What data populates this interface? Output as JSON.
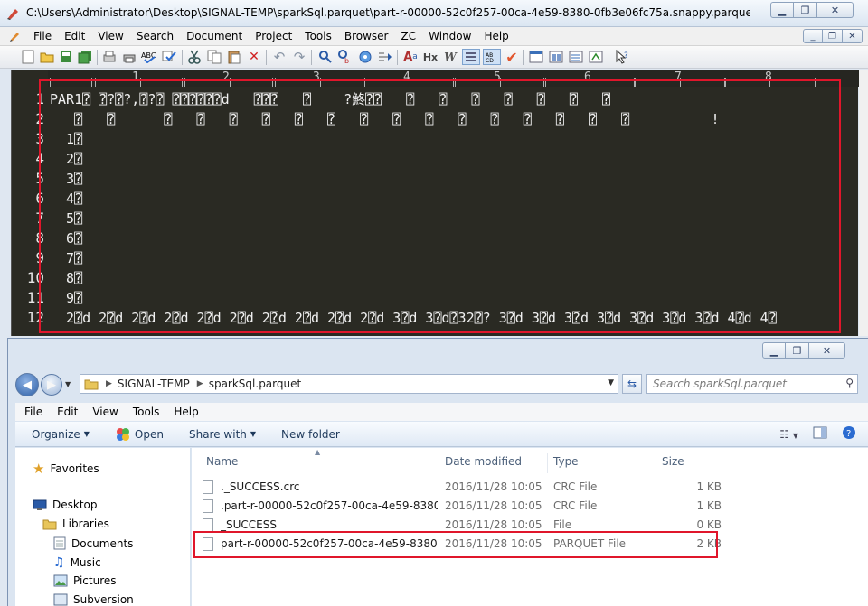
{
  "editplus": {
    "title": "C:\\Users\\Administrator\\Desktop\\SIGNAL-TEMP\\sparkSql.parquet\\part-r-00000-52c0f257-00ca-4e59-8380-0fb3e06fc75a.snappy.parquet - EditPlus",
    "menu": [
      "File",
      "Edit",
      "View",
      "Search",
      "Document",
      "Project",
      "Tools",
      "Browser",
      "ZC",
      "Window",
      "Help"
    ],
    "ruler": [
      "1",
      "2",
      "3",
      "4",
      "5",
      "6",
      "7",
      "8"
    ],
    "line_numbers": [
      "1",
      "2",
      "3",
      "4",
      "5",
      "6",
      "7",
      "8",
      "9",
      "10",
      "11",
      "12"
    ],
    "lines": [
      "PAR1⍰ ⍰?⍰?,⍰?⍰ ⍰⍰⍰⍰⍰⍰d   ⍰⍰⍰   ⍰    ?鮗⍰⍰   ⍰   ⍰   ⍰   ⍰   ⍰   ⍰   ⍰",
      "   ⍰   ⍰      ⍰   ⍰   ⍰   ⍰   ⍰   ⍰   ⍰   ⍰   ⍰   ⍰   ⍰   ⍰   ⍰   ⍰   ⍰          !",
      "  1⍰",
      "  2⍰",
      "  3⍰",
      "  4⍰",
      "  5⍰",
      "  6⍰",
      "  7⍰",
      "  8⍰",
      "  9⍰",
      "  2⍰d 2⍰d 2⍰d 2⍰d 2⍰d 2⍰d 2⍰d 2⍰d 2⍰d 2⍰d 3⍰d 3⍰d⍰32⍰? 3⍰d 3⍰d 3⍰d 3⍰d 3⍰d 3⍰d 3⍰d 4⍰d 4⍰"
    ]
  },
  "explorer": {
    "breadcrumb": [
      "SIGNAL-TEMP",
      "sparkSql.parquet"
    ],
    "search_placeholder": "Search sparkSql.parquet",
    "menu": [
      "File",
      "Edit",
      "View",
      "Tools",
      "Help"
    ],
    "commands": {
      "organize": "Organize",
      "open": "Open",
      "share": "Share with",
      "newfolder": "New folder"
    },
    "nav": {
      "favorites": "Favorites",
      "desktop": "Desktop",
      "libraries": "Libraries",
      "documents": "Documents",
      "music": "Music",
      "pictures": "Pictures",
      "subversion": "Subversion"
    },
    "columns": {
      "name": "Name",
      "date": "Date modified",
      "type": "Type",
      "size": "Size"
    },
    "files": [
      {
        "name": "._SUCCESS.crc",
        "date": "2016/11/28 10:05",
        "type": "CRC File",
        "size": "1 KB"
      },
      {
        "name": ".part-r-00000-52c0f257-00ca-4e59-8380-0...",
        "date": "2016/11/28 10:05",
        "type": "CRC File",
        "size": "1 KB"
      },
      {
        "name": "_SUCCESS",
        "date": "2016/11/28 10:05",
        "type": "File",
        "size": "0 KB"
      },
      {
        "name": "part-r-00000-52c0f257-00ca-4e59-8380-0...",
        "date": "2016/11/28 10:05",
        "type": "PARQUET File",
        "size": "2 KB"
      }
    ]
  },
  "colors": {
    "editor_bg": "#2a2a23",
    "highlight": "#e0162b",
    "explorer_chrome": "#dbe5f1"
  }
}
